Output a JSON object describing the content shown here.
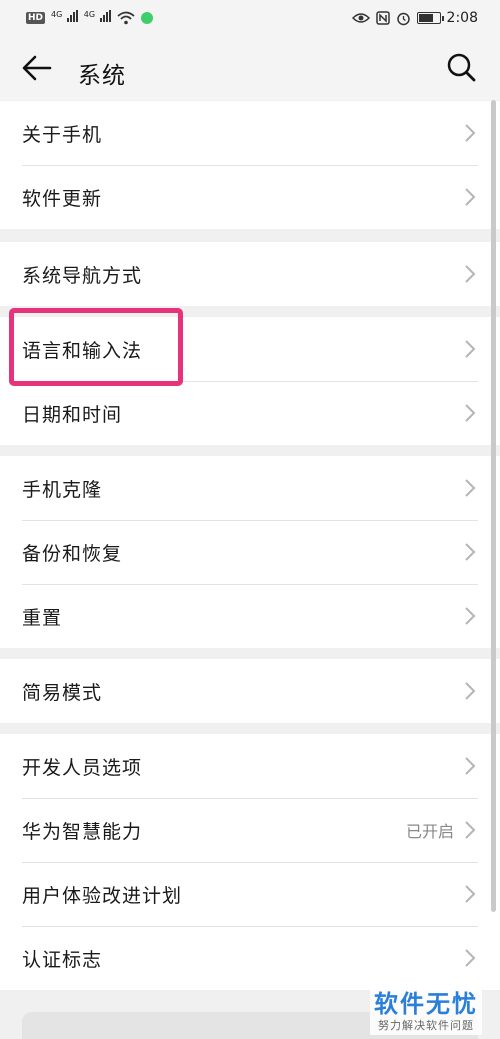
{
  "status_bar": {
    "hd": "HD",
    "net1": "4G",
    "net2": "4G",
    "time": "2:08",
    "battery_level": 0.7
  },
  "header": {
    "title": "系统"
  },
  "groups": [
    {
      "items": [
        {
          "label": "关于手机"
        },
        {
          "label": "软件更新"
        }
      ]
    },
    {
      "items": [
        {
          "label": "系统导航方式"
        }
      ]
    },
    {
      "items": [
        {
          "label": "语言和输入法"
        },
        {
          "label": "日期和时间"
        }
      ]
    },
    {
      "items": [
        {
          "label": "手机克隆"
        },
        {
          "label": "备份和恢复"
        },
        {
          "label": "重置"
        }
      ]
    },
    {
      "items": [
        {
          "label": "简易模式"
        }
      ]
    },
    {
      "items": [
        {
          "label": "开发人员选项"
        },
        {
          "label": "华为智慧能力",
          "status": "已开启"
        },
        {
          "label": "用户体验改进计划"
        },
        {
          "label": "认证标志"
        }
      ]
    }
  ],
  "watermark": {
    "main": "软件无忧",
    "sub": "努力解决软件问题"
  },
  "colors": {
    "highlight": "#e6337a",
    "watermark": "#2a7fd8"
  }
}
